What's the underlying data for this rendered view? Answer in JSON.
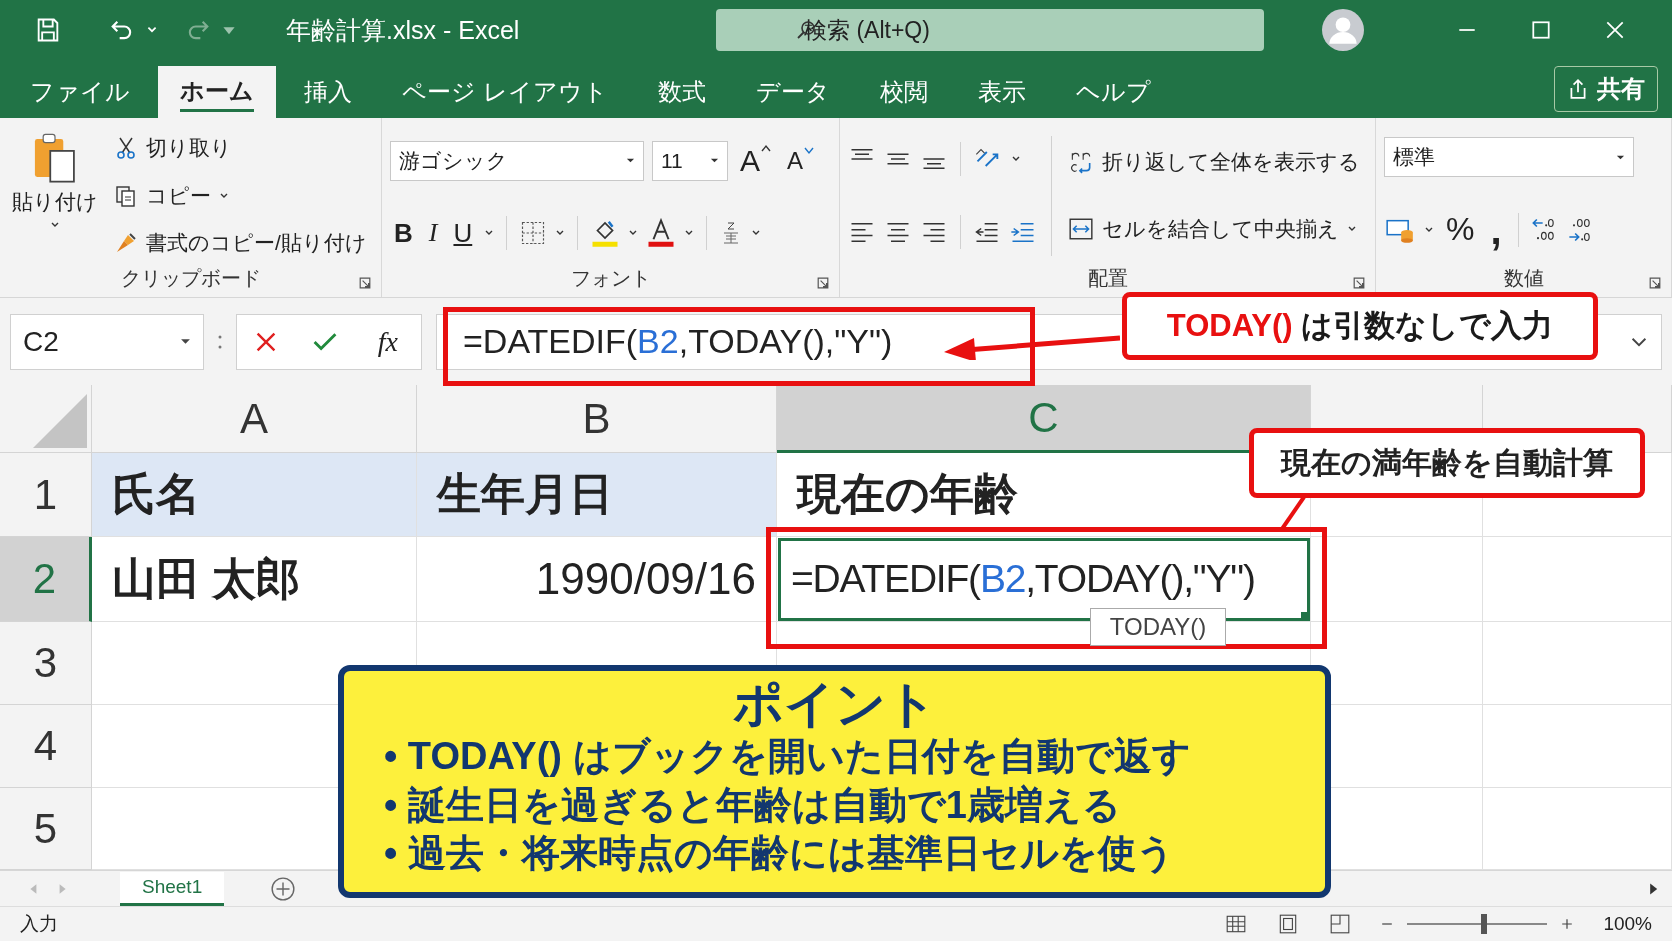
{
  "window": {
    "title": "年齢計算.xlsx - Excel",
    "search_placeholder": "検索 (Alt+Q)",
    "redo_disabled": true
  },
  "tabs": [
    {
      "label": "ファイル",
      "selected": false
    },
    {
      "label": "ホーム",
      "selected": true
    },
    {
      "label": "挿入",
      "selected": false
    },
    {
      "label": "ページ レイアウト",
      "selected": false
    },
    {
      "label": "数式",
      "selected": false
    },
    {
      "label": "データ",
      "selected": false
    },
    {
      "label": "校閲",
      "selected": false
    },
    {
      "label": "表示",
      "selected": false
    },
    {
      "label": "ヘルプ",
      "selected": false
    }
  ],
  "share": "共有",
  "ribbon": {
    "clipboard": {
      "paste": "貼り付け",
      "cut": "切り取り",
      "copy": "コピー",
      "format_painter": "書式のコピー/貼り付け",
      "label": "クリップボード"
    },
    "font": {
      "name": "游ゴシック",
      "size": "11",
      "grow": "A",
      "shrink": "A",
      "styles": [
        "B",
        "I",
        "U"
      ],
      "label": "フォント"
    },
    "alignment": {
      "wrap": "折り返して全体を表示する",
      "merge": "セルを結合して中央揃え",
      "label": "配置"
    },
    "number": {
      "format": "標準",
      "percent": "%",
      "comma": ",",
      "label": "数値"
    }
  },
  "formula_bar": {
    "name_box": "C2",
    "fx": "fx",
    "formula": [
      {
        "kind": "plain",
        "text": "=DATEDIF("
      },
      {
        "kind": "ref",
        "text": "B2"
      },
      {
        "kind": "plain",
        "text": ",TODAY(),\"Y\")"
      }
    ]
  },
  "columns": [
    {
      "label": "A",
      "selected": false
    },
    {
      "label": "B",
      "selected": false
    },
    {
      "label": "C",
      "selected": true
    }
  ],
  "rows": [
    {
      "label": "1",
      "selected": false,
      "cells": [
        {
          "kind": "text",
          "text": "氏名",
          "highlighted": true
        },
        {
          "kind": "text",
          "text": "生年月日",
          "highlighted": true
        },
        {
          "kind": "text",
          "text": "現在の年齢",
          "highlighted": false
        }
      ]
    },
    {
      "label": "2",
      "selected": true,
      "cells": [
        {
          "kind": "text",
          "text": "山田 太郎",
          "highlighted": false
        },
        {
          "kind": "number",
          "text": "1990/09/16",
          "highlighted": false
        },
        {
          "kind": "formula",
          "selected": true,
          "parts": [
            {
              "kind": "plain",
              "text": "=DATEDIF("
            },
            {
              "kind": "ref",
              "text": "B2"
            },
            {
              "kind": "plain",
              "text": ",TODAY(),\"Y\")"
            }
          ]
        }
      ]
    },
    {
      "label": "3",
      "selected": false
    },
    {
      "label": "4",
      "selected": false
    },
    {
      "label": "5",
      "selected": false
    }
  ],
  "tooltip": "TODAY()",
  "callouts": {
    "formula": {
      "code": "TODAY()",
      "text": "は引数なしで入力"
    },
    "cell": "現在の満年齢を自動計算"
  },
  "point": {
    "title": "ポイント",
    "bullets": [
      "• TODAY() はブックを開いた日付を自動で返す",
      "• 誕生日を過ぎると年齢は自動で1歳増える",
      "• 過去・将来時点の年齢には基準日セルを使う"
    ]
  },
  "sheets": [
    {
      "label": "Sheet1",
      "selected": true
    }
  ],
  "status": {
    "mode": "入力",
    "zoom": {
      "level": 0.55
    },
    "zoom_label": "100%"
  }
}
